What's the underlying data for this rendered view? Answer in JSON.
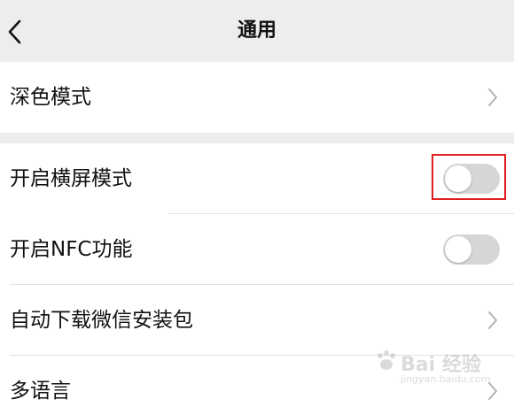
{
  "nav": {
    "title": "通用",
    "back_icon": "chevron-left-icon"
  },
  "settings": {
    "dark_mode": {
      "label": "深色模式",
      "icon": "chevron-right-icon"
    },
    "landscape_mode": {
      "label": "开启横屏模式",
      "toggle_on": false
    },
    "nfc": {
      "label": "开启NFC功能",
      "toggle_on": false
    },
    "auto_download": {
      "label": "自动下载微信安装包",
      "icon": "chevron-right-icon"
    },
    "language": {
      "label": "多语言",
      "icon": "chevron-right-icon"
    }
  },
  "watermark": {
    "brand": "Bai 经验",
    "domain": "jingyan.baidu.com"
  },
  "colors": {
    "background": "#ededed",
    "row_background": "#ffffff",
    "toggle_off": "#d6d6d6",
    "highlight_box": "#e02020"
  }
}
